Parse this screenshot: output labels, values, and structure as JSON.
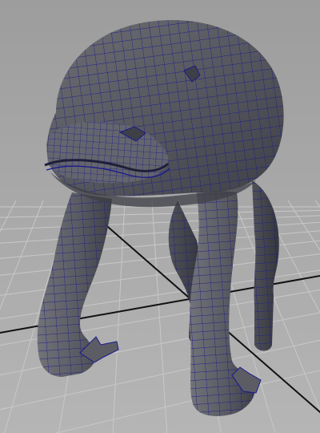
{
  "viewport": {
    "background_color": "#a8a8a8",
    "grid_line_color": "#c8c8c8",
    "axis_line_color": "#111111",
    "mesh_fill_color": "#5f5f63",
    "mesh_shadow_color": "#3e3f45",
    "wireframe_color": "#1a1a8c"
  },
  "model": {
    "subject": "creature-wireframe-model"
  }
}
